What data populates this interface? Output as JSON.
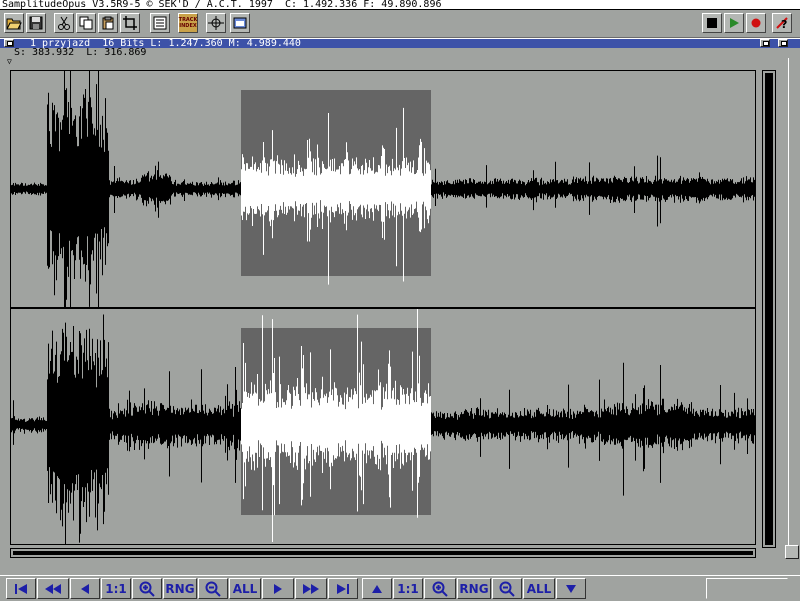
{
  "app": {
    "title": "SamplitudeOpus V3.5R9-5 © SEK'D / A.C.T. 1997  C: 1.492.336 F: 49.890.896"
  },
  "toolbar": {
    "icons": [
      "open-folder-icon",
      "save-disk-icon",
      "cut-scissors-icon",
      "copy-icon",
      "paste-icon",
      "crop-icon",
      "list-icon",
      "track-index-icon",
      "loop-icon",
      "window-icon",
      "stop-icon",
      "play-icon",
      "record-icon",
      "help-icon"
    ],
    "track_index_label_1": "TRACK",
    "track_index_label_2": "INDEX"
  },
  "sample_window": {
    "title": "1_przyjazd  16 Bits L: 1.247.360 M: 4.989.440",
    "info": "S: 383.932  L: 316.869"
  },
  "transport": {
    "ratio_label": "1:1",
    "range_label": "RNG",
    "all_label": "ALL",
    "ratio_label_v": "1:1",
    "range_label_v": "RNG",
    "all_label_v": "ALL"
  },
  "colors": {
    "background": "#a0a3a0",
    "selection": "#656565",
    "waveform": "#000000",
    "waveform_selected": "#ffffff",
    "title_active": "#3d52a8",
    "button_text": "#1d1fa8"
  }
}
